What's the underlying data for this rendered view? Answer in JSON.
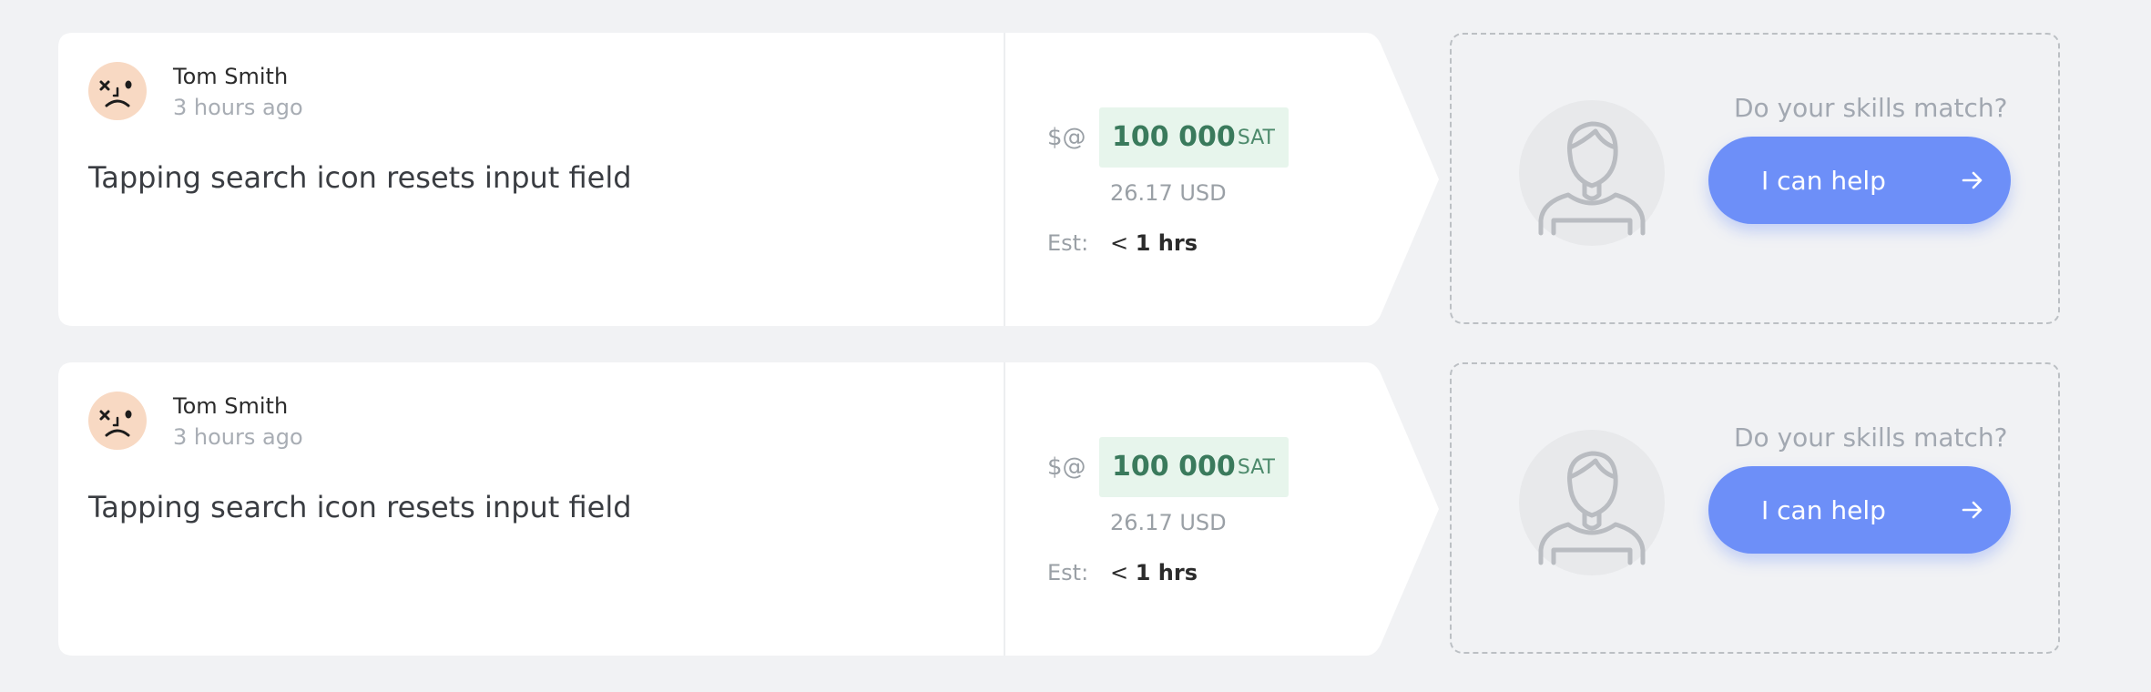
{
  "tasks": [
    {
      "author": {
        "name": "Tom Smith",
        "time": "3 hours ago",
        "avatar_icon": "dizzy-face-icon"
      },
      "title": "Tapping search icon resets input field",
      "price": {
        "prefix": "$@",
        "amount": "100 000",
        "unit": "SAT",
        "usd": "26.17 USD"
      },
      "estimate": {
        "label": "Est:",
        "prefix": "<",
        "value": "1 hrs"
      },
      "help": {
        "prompt": "Do your skills match?",
        "button_label": "I can help",
        "icon": "arrow-right-icon"
      }
    },
    {
      "author": {
        "name": "Tom Smith",
        "time": "3 hours ago",
        "avatar_icon": "dizzy-face-icon"
      },
      "title": "Tapping search icon resets input field",
      "price": {
        "prefix": "$@",
        "amount": "100 000",
        "unit": "SAT",
        "usd": "26.17 USD"
      },
      "estimate": {
        "label": "Est:",
        "prefix": "<",
        "value": "1 hrs"
      },
      "help": {
        "prompt": "Do your skills match?",
        "button_label": "I can help",
        "icon": "arrow-right-icon"
      }
    }
  ],
  "colors": {
    "background": "#f1f2f4",
    "card": "#ffffff",
    "price_bg": "#e7f5ec",
    "price_text": "#3a7a5c",
    "button": "#6d8ff8",
    "avatar_bg": "#f8d9c3"
  }
}
